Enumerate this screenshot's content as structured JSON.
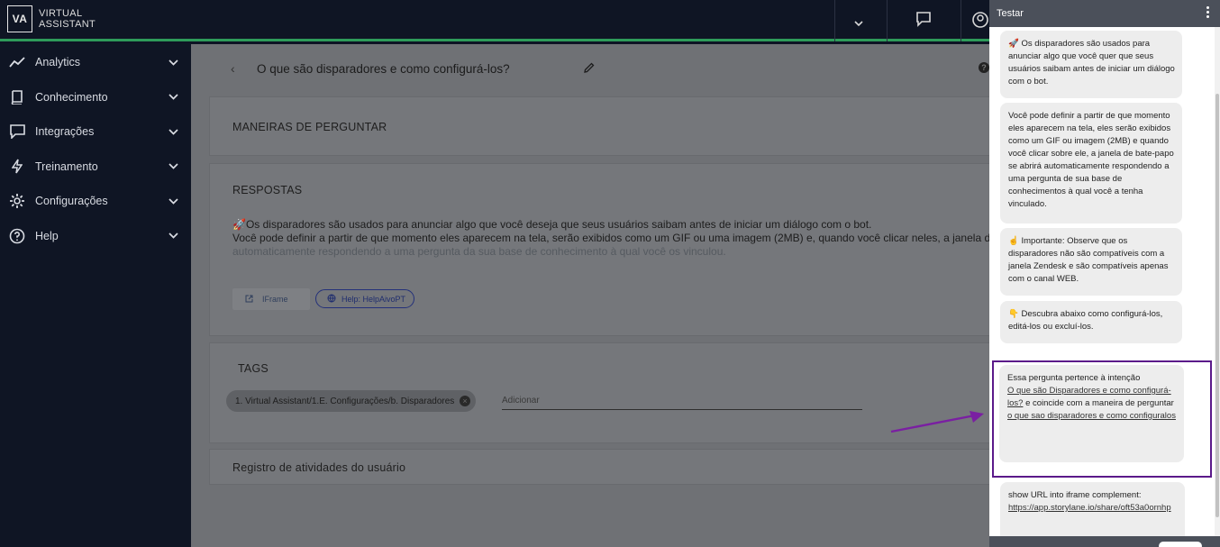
{
  "app": {
    "logo_abbr": "VA",
    "logo_line1": "VIRTUAL",
    "logo_line2": "ASSISTANT"
  },
  "sidebar": {
    "items": [
      {
        "label": "Analytics",
        "icon": "analytics-icon"
      },
      {
        "label": "Conhecimento",
        "icon": "book-icon"
      },
      {
        "label": "Integrações",
        "icon": "chat-icon"
      },
      {
        "label": "Treinamento",
        "icon": "bolt-icon"
      },
      {
        "label": "Configurações",
        "icon": "gear-icon"
      },
      {
        "label": "Help",
        "icon": "help-icon"
      }
    ]
  },
  "main": {
    "back_glyph": "‹",
    "page_title": "O que são disparadores e como configurá-los?",
    "help_glyph": "?",
    "maneiras_title": "MANEIRAS DE PERGUNTAR",
    "respostas_title": "RESPOSTAS",
    "resp_line1": "Os disparadores são usados para anunciar algo que você deseja que seus usuários saibam antes de iniciar um diálogo com o bot.",
    "resp_line2": "Você pode definir a partir de que momento eles aparecem na tela, serão exibidos como um GIF ou uma imagem (2MB) e, quando você clicar neles, a janela de bate",
    "resp_line3": "automaticamente respondendo a uma pergunta da sua base de conhecimento à qual você os vinculou.",
    "iframe_label": "IFrame",
    "help_button_label": "Help: HelpAivoPT",
    "tags_title": "TAGS",
    "tag_chip": "1. Virtual Assistant/1.E. Configurações/b. Disparadores",
    "tag_placeholder": "Adicionar",
    "registro_title": "Registro de atividades do usuário"
  },
  "panel": {
    "title": "Testar",
    "b1": "Os disparadores são usados para anunciar algo que você quer que seus usuários saibam antes de iniciar um diálogo com o bot.",
    "b2": "Você pode definir a partir de que momento eles aparecem na tela, eles serão exibidos como um GIF ou imagem (2MB) e quando você clicar sobre ele, a janela de bate-papo se abrirá automaticamente respondendo a uma pergunta de sua base de conhecimentos à qual você a tenha vinculado.",
    "b3": "Importante: Observe que os disparadores não são compatíveis com a janela Zendesk e são compatíveis apenas com o canal WEB.",
    "b4": "Descubra abaixo como configurá-los, editá-los ou excluí-los.",
    "b5_pre": "Essa pergunta pertence à intenção",
    "b5_link1": "O que são Disparadores e como configurá-los?",
    "b5_mid": " e coincide com a maneira de perguntar",
    "b5_link2": "o que sao disparadores e como configuralos",
    "b6_pre": "show URL into iframe complement:",
    "b6_link": "https://app.storylane.io/share/oft53a0ornhp"
  },
  "colors": {
    "accent_green": "#2e9b5a",
    "highlight_purple": "#5b1a8a",
    "arrow_purple": "#7a1fa2"
  }
}
